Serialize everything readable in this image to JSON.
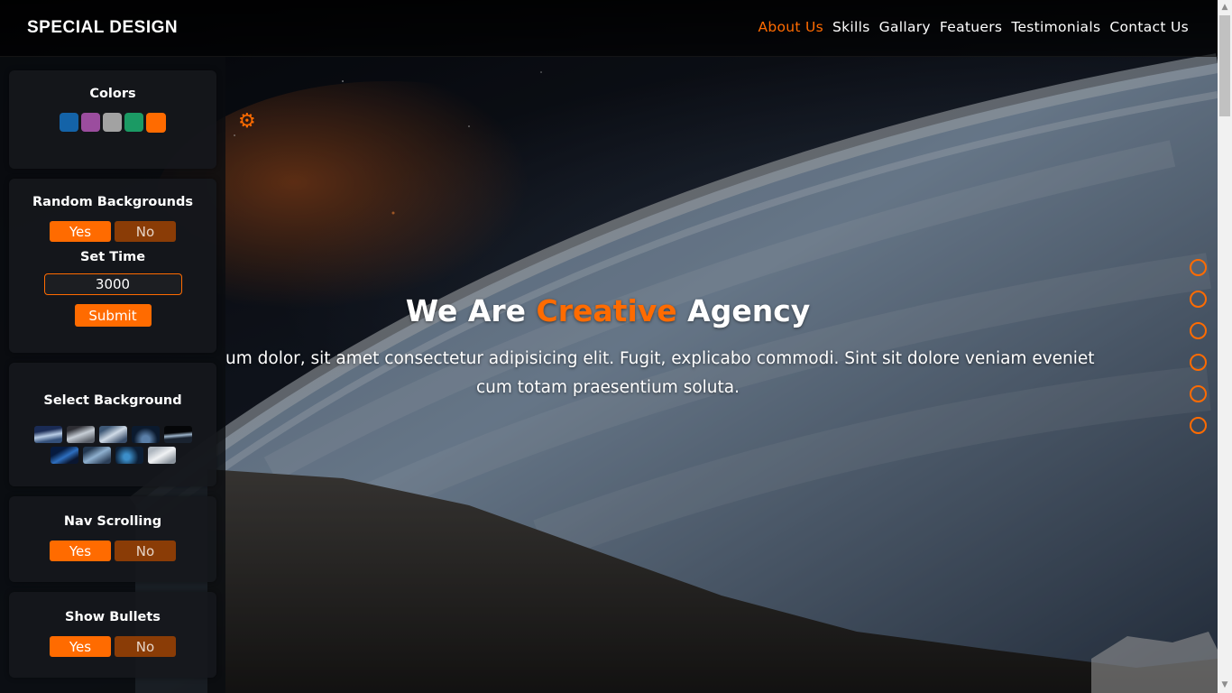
{
  "header": {
    "logo": "SPECIAL DESIGN",
    "nav": [
      "About Us",
      "Skills",
      "Gallary",
      "Featuers",
      "Testimonials",
      "Contact Us"
    ]
  },
  "settings": {
    "colors": {
      "title": "Colors",
      "swatches": [
        "#1463a8",
        "#9b4d9e",
        "#a2a2a2",
        "#1b9a64",
        "#ff6b00"
      ],
      "active_index": 4
    },
    "random": {
      "title": "Random Backgrounds",
      "yes": "Yes",
      "no": "No",
      "set_time_label": "Set Time",
      "time_value": "3000",
      "submit": "Submit"
    },
    "select_background": {
      "title": "Select Background"
    },
    "nav_scrolling": {
      "title": "Nav Scrolling",
      "yes": "Yes",
      "no": "No"
    },
    "show_bullets": {
      "title": "Show Bullets",
      "yes": "Yes",
      "no": "No"
    }
  },
  "hero": {
    "title_start": "We Are",
    "title_accent": "Creative",
    "title_end": "Agency",
    "text_line1": "um dolor, sit amet consectetur adipisicing elit. Fugit, explicabo commodi. Sint sit dolore veniam eveniet",
    "text_line2": "cum totam praesentium soluta."
  },
  "theme": {
    "accent": "#ff6b00"
  }
}
